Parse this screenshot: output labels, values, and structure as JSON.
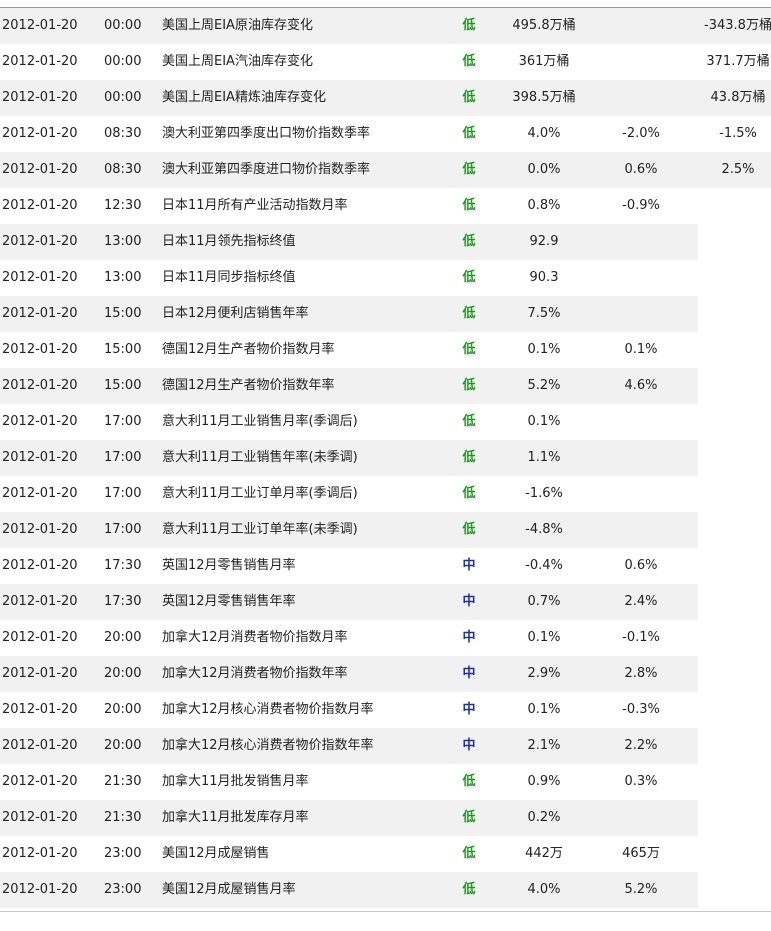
{
  "colors": {
    "importance_low": "#1f9a1f",
    "importance_mid": "#1c2fa8",
    "row_alt_bg": "#f1f1f1"
  },
  "rows": [
    {
      "date": "2012-01-20",
      "time": "00:00",
      "event": "美国上周EIA原油库存变化",
      "importance": "低",
      "level": "low",
      "actual": "495.8万桶",
      "forecast": "",
      "previous": "-343.8万桶"
    },
    {
      "date": "2012-01-20",
      "time": "00:00",
      "event": "美国上周EIA汽油库存变化",
      "importance": "低",
      "level": "low",
      "actual": "361万桶",
      "forecast": "",
      "previous": "371.7万桶"
    },
    {
      "date": "2012-01-20",
      "time": "00:00",
      "event": "美国上周EIA精炼油库存变化",
      "importance": "低",
      "level": "low",
      "actual": "398.5万桶",
      "forecast": "",
      "previous": "43.8万桶"
    },
    {
      "date": "2012-01-20",
      "time": "08:30",
      "event": "澳大利亚第四季度出口物价指数季率",
      "importance": "低",
      "level": "low",
      "actual": "4.0%",
      "forecast": "-2.0%",
      "previous": "-1.5%"
    },
    {
      "date": "2012-01-20",
      "time": "08:30",
      "event": "澳大利亚第四季度进口物价指数季率",
      "importance": "低",
      "level": "low",
      "actual": "0.0%",
      "forecast": "0.6%",
      "previous": "2.5%"
    },
    {
      "date": "2012-01-20",
      "time": "12:30",
      "event": "日本11月所有产业活动指数月率",
      "importance": "低",
      "level": "low",
      "actual": "0.8%",
      "forecast": "-0.9%",
      "previous": ""
    },
    {
      "date": "2012-01-20",
      "time": "13:00",
      "event": "日本11月领先指标终值",
      "importance": "低",
      "level": "low",
      "actual": "92.9",
      "forecast": "",
      "previous": ""
    },
    {
      "date": "2012-01-20",
      "time": "13:00",
      "event": "日本11月同步指标终值",
      "importance": "低",
      "level": "low",
      "actual": "90.3",
      "forecast": "",
      "previous": ""
    },
    {
      "date": "2012-01-20",
      "time": "15:00",
      "event": "日本12月便利店销售年率",
      "importance": "低",
      "level": "low",
      "actual": "7.5%",
      "forecast": "",
      "previous": ""
    },
    {
      "date": "2012-01-20",
      "time": "15:00",
      "event": "德国12月生产者物价指数月率",
      "importance": "低",
      "level": "low",
      "actual": "0.1%",
      "forecast": "0.1%",
      "previous": ""
    },
    {
      "date": "2012-01-20",
      "time": "15:00",
      "event": "德国12月生产者物价指数年率",
      "importance": "低",
      "level": "low",
      "actual": "5.2%",
      "forecast": "4.6%",
      "previous": ""
    },
    {
      "date": "2012-01-20",
      "time": "17:00",
      "event": "意大利11月工业销售月率(季调后)",
      "importance": "低",
      "level": "low",
      "actual": "0.1%",
      "forecast": "",
      "previous": ""
    },
    {
      "date": "2012-01-20",
      "time": "17:00",
      "event": "意大利11月工业销售年率(未季调)",
      "importance": "低",
      "level": "low",
      "actual": "1.1%",
      "forecast": "",
      "previous": ""
    },
    {
      "date": "2012-01-20",
      "time": "17:00",
      "event": "意大利11月工业订单月率(季调后)",
      "importance": "低",
      "level": "low",
      "actual": "-1.6%",
      "forecast": "",
      "previous": ""
    },
    {
      "date": "2012-01-20",
      "time": "17:00",
      "event": "意大利11月工业订单年率(未季调)",
      "importance": "低",
      "level": "low",
      "actual": "-4.8%",
      "forecast": "",
      "previous": ""
    },
    {
      "date": "2012-01-20",
      "time": "17:30",
      "event": "英国12月零售销售月率",
      "importance": "中",
      "level": "mid",
      "actual": "-0.4%",
      "forecast": "0.6%",
      "previous": ""
    },
    {
      "date": "2012-01-20",
      "time": "17:30",
      "event": "英国12月零售销售年率",
      "importance": "中",
      "level": "mid",
      "actual": "0.7%",
      "forecast": "2.4%",
      "previous": ""
    },
    {
      "date": "2012-01-20",
      "time": "20:00",
      "event": "加拿大12月消费者物价指数月率",
      "importance": "中",
      "level": "mid",
      "actual": "0.1%",
      "forecast": "-0.1%",
      "previous": ""
    },
    {
      "date": "2012-01-20",
      "time": "20:00",
      "event": "加拿大12月消费者物价指数年率",
      "importance": "中",
      "level": "mid",
      "actual": "2.9%",
      "forecast": "2.8%",
      "previous": ""
    },
    {
      "date": "2012-01-20",
      "time": "20:00",
      "event": "加拿大12月核心消费者物价指数月率",
      "importance": "中",
      "level": "mid",
      "actual": "0.1%",
      "forecast": "-0.3%",
      "previous": ""
    },
    {
      "date": "2012-01-20",
      "time": "20:00",
      "event": "加拿大12月核心消费者物价指数年率",
      "importance": "中",
      "level": "mid",
      "actual": "2.1%",
      "forecast": "2.2%",
      "previous": ""
    },
    {
      "date": "2012-01-20",
      "time": "21:30",
      "event": "加拿大11月批发销售月率",
      "importance": "低",
      "level": "low",
      "actual": "0.9%",
      "forecast": "0.3%",
      "previous": ""
    },
    {
      "date": "2012-01-20",
      "time": "21:30",
      "event": "加拿大11月批发库存月率",
      "importance": "低",
      "level": "low",
      "actual": "0.2%",
      "forecast": "",
      "previous": ""
    },
    {
      "date": "2012-01-20",
      "time": "23:00",
      "event": "美国12月成屋销售",
      "importance": "低",
      "level": "low",
      "actual": "442万",
      "forecast": "465万",
      "previous": ""
    },
    {
      "date": "2012-01-20",
      "time": "23:00",
      "event": "美国12月成屋销售月率",
      "importance": "低",
      "level": "low",
      "actual": "4.0%",
      "forecast": "5.2%",
      "previous": ""
    }
  ]
}
